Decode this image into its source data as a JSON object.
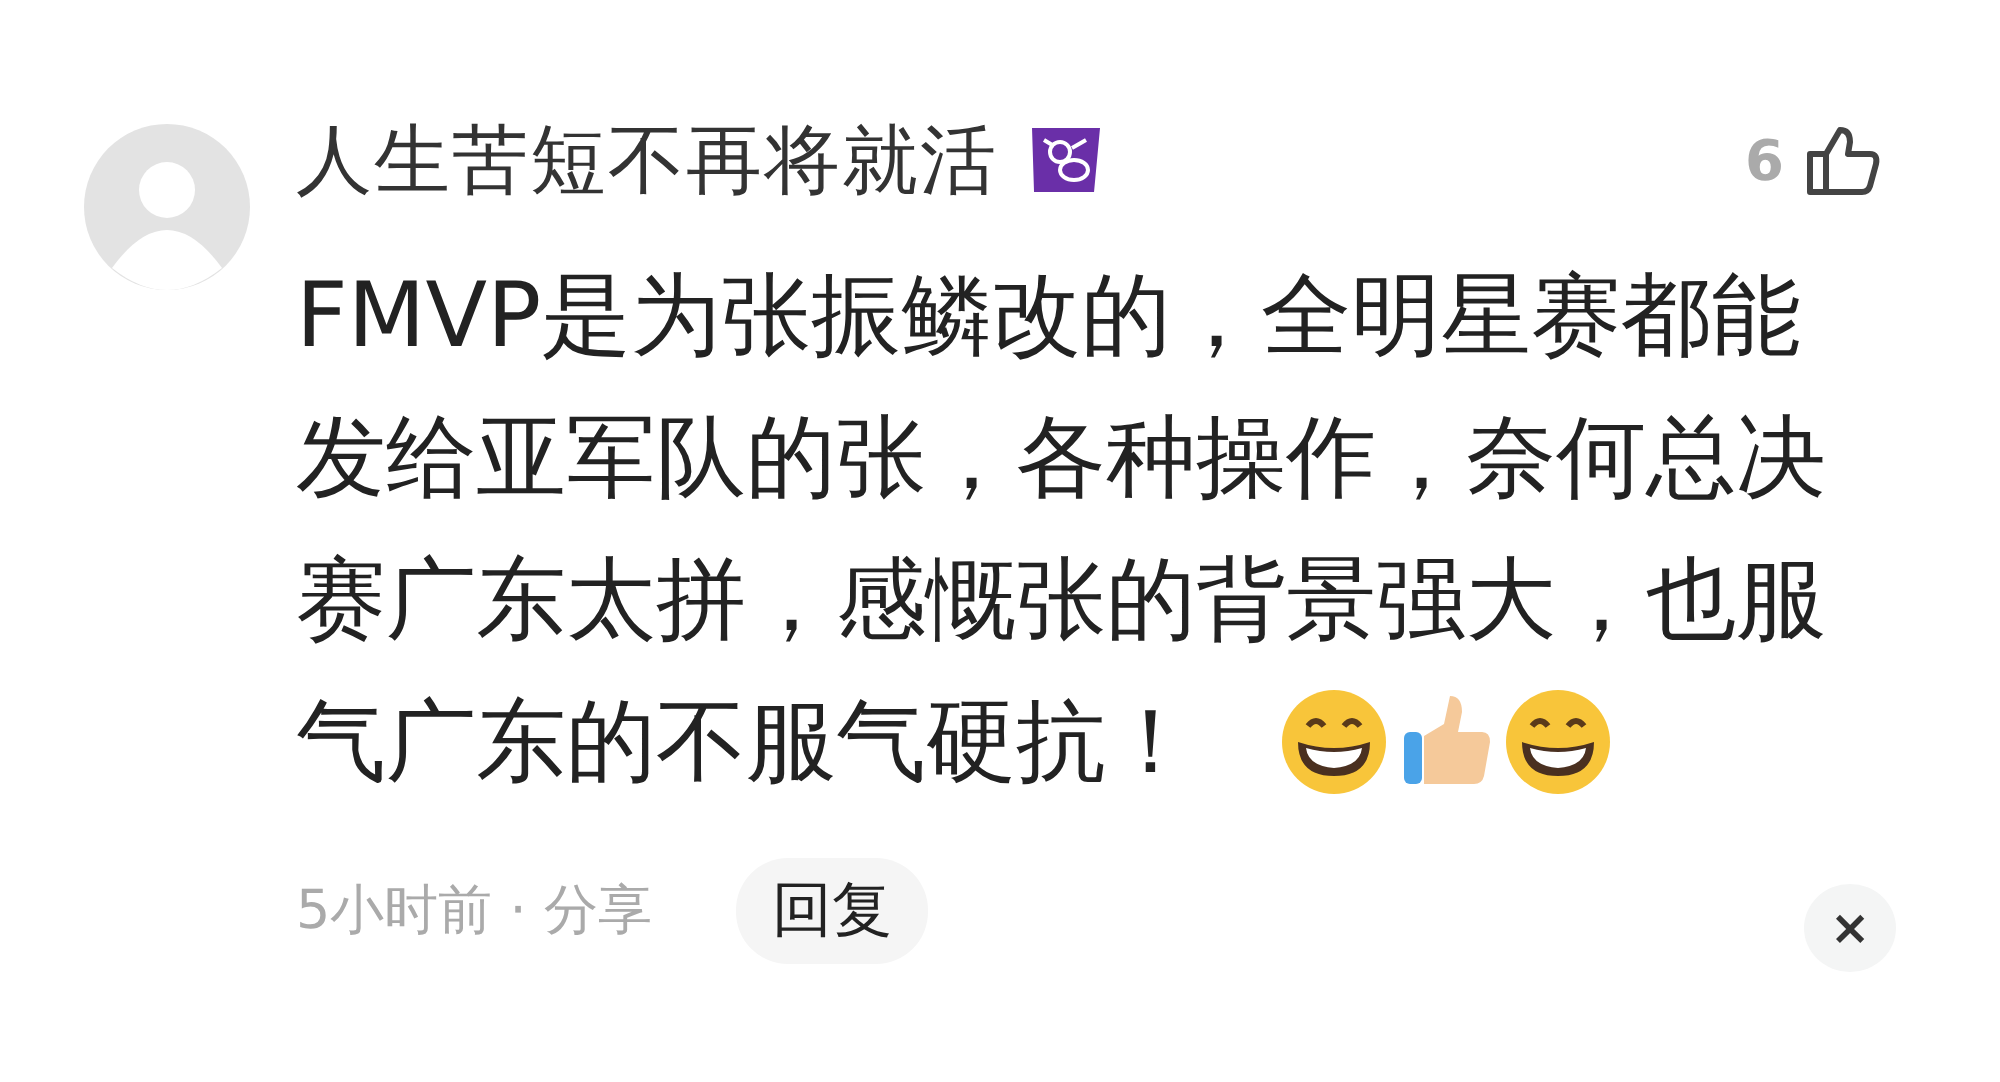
{
  "comment": {
    "author": "人生苦短不再将就活",
    "like_count": "6",
    "body_lines": [
      "FMVP是为张振鳞改的，全明星赛都能",
      "发给亚军队的张，各种操作，奈何总决",
      "赛广东太拼，感慨张的背景强大，也服",
      "气广东的不服气硬抗！"
    ],
    "emojis": [
      {
        "kind": "grin"
      },
      {
        "kind": "thumbs"
      },
      {
        "kind": "grin"
      }
    ],
    "time": "5小时前 · 分享",
    "reply_button": "回复",
    "close_button": "×"
  }
}
